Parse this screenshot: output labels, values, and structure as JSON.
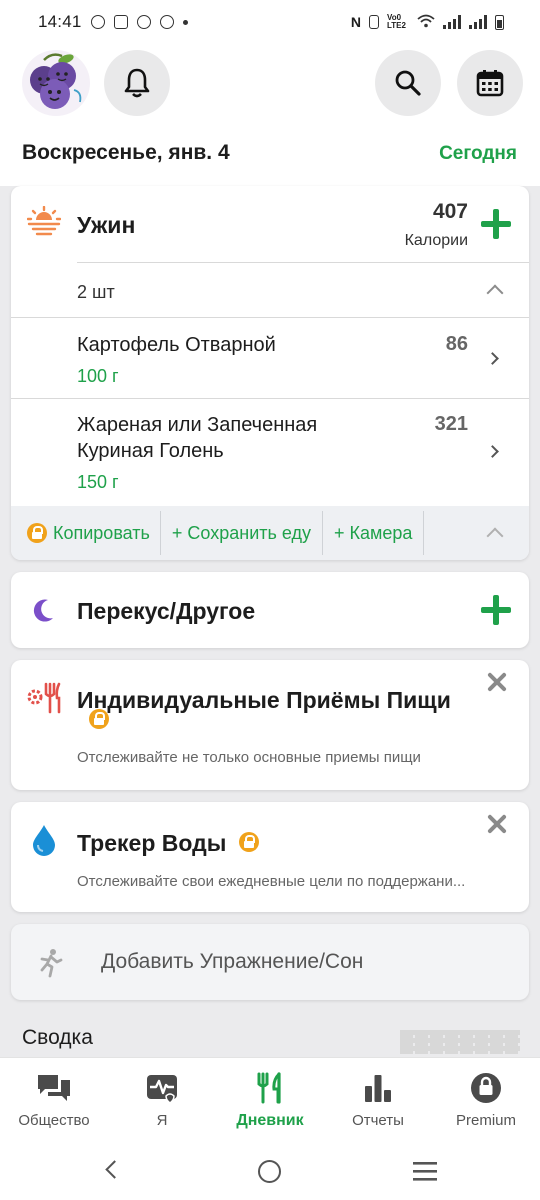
{
  "status_bar": {
    "time": "14:41",
    "network_label": "Vo0 LTE2"
  },
  "header": {
    "date": "Воскресенье, янв. 4",
    "today_link": "Сегодня"
  },
  "meal": {
    "title": "Ужин",
    "calories": "407",
    "calories_label": "Калории",
    "item_count": "2 шт",
    "items": [
      {
        "name": "Картофель Отварной",
        "amount": "100 г",
        "calories": "86"
      },
      {
        "name": "Жареная или Запеченная Куриная Голень",
        "amount": "150 г",
        "calories": "321"
      }
    ],
    "actions": {
      "copy": "Копировать",
      "save_food": "+ Сохранить еду",
      "camera": "+ Камера"
    }
  },
  "snack": {
    "title": "Перекус/Другое"
  },
  "custom_meals": {
    "title": "Индивидуальные Приёмы Пищи",
    "description": "Отслеживайте не только основные приемы пищи"
  },
  "water": {
    "title": "Трекер Воды",
    "description": "Отслеживайте свои ежедневные цели по поддержани..."
  },
  "exercise": {
    "label": "Добавить Упражнение/Сон"
  },
  "summary": {
    "title": "Сводка"
  },
  "bottom_nav": [
    {
      "label": "Общество",
      "icon": "chat-icon",
      "active": false
    },
    {
      "label": "Я",
      "icon": "heart-pulse-icon",
      "active": false
    },
    {
      "label": "Дневник",
      "icon": "fork-knife-icon",
      "active": true
    },
    {
      "label": "Отчеты",
      "icon": "bar-chart-icon",
      "active": false
    },
    {
      "label": "Premium",
      "icon": "premium-lock-icon",
      "active": false
    }
  ],
  "colors": {
    "accent_green": "#1fa14a",
    "premium_orange": "#f0a21b",
    "snack_purple": "#7b4fc9",
    "water_blue": "#1a8fd6",
    "dinner_orange": "#f28a4c",
    "custom_meal_red": "#e2504a"
  }
}
